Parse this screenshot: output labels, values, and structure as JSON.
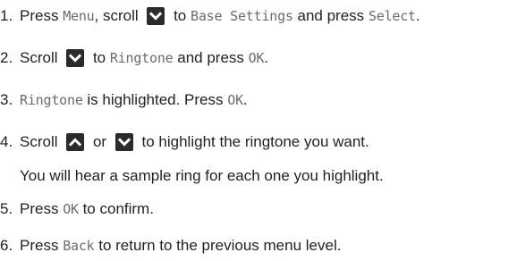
{
  "steps": [
    {
      "num": "1.",
      "t1": "Press ",
      "lcd1": "Menu",
      "t2": ", scroll ",
      "icon": "chevron-down-icon",
      "t3": " to ",
      "lcd2": "Base Settings",
      "t4": " and press ",
      "lcd3": "Select",
      "t5": "."
    },
    {
      "num": "2.",
      "t1": "Scroll ",
      "icon": "chevron-down-icon",
      "t2": " to ",
      "lcd1": "Ringtone",
      "t3": " and press ",
      "lcd2": "OK",
      "t4": "."
    },
    {
      "num": "3.",
      "lcd1": "Ringtone",
      "t1": " is highlighted. Press ",
      "lcd2": "OK",
      "t2": "."
    },
    {
      "num": "4.",
      "t1": "Scroll ",
      "icon1": "chevron-up-icon",
      "t2": " or ",
      "icon2": "chevron-down-icon",
      "t3": " to highlight the ringtone you want.",
      "note": "You will hear a sample ring for each one you highlight."
    },
    {
      "num": "5.",
      "t1": "Press ",
      "lcd1": "OK",
      "t2": " to confirm."
    },
    {
      "num": "6.",
      "t1": "Press ",
      "lcd1": "Back",
      "t2": " to return to the previous menu level."
    }
  ]
}
